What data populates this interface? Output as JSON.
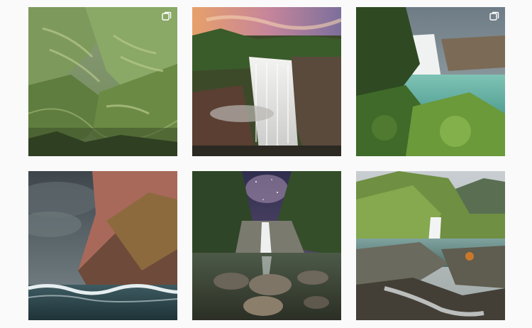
{
  "grid": {
    "posts": [
      {
        "subject": "terraced-green-valley",
        "multi_photo": true
      },
      {
        "subject": "sunset-waterfall-cliff",
        "multi_photo": false
      },
      {
        "subject": "turquoise-lake-waterfall",
        "multi_photo": true
      },
      {
        "subject": "sea-cliff-storm-waves",
        "multi_photo": false
      },
      {
        "subject": "milky-way-waterfall-rocks",
        "multi_photo": false
      },
      {
        "subject": "mossy-river-cascade",
        "multi_photo": false
      }
    ]
  },
  "icons": {
    "multi_photo_badge": "carousel-icon"
  }
}
